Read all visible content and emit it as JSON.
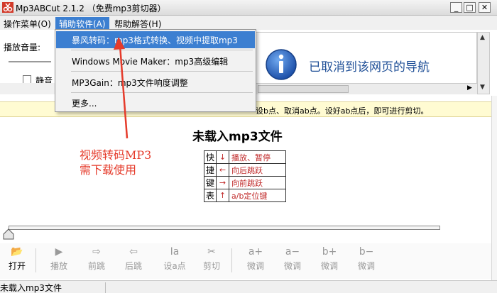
{
  "window": {
    "title": "Mp3ABCut 2.1.2 （免费mp3剪切器）",
    "minimize_glyph": "_",
    "maximize_glyph": "□",
    "close_glyph": "✕"
  },
  "menu": {
    "items": [
      "操作菜单(O)",
      "辅助软件(A)",
      "帮助解答(H)"
    ]
  },
  "dropdown": {
    "items": [
      "暴风转码：mp3格式转换、视频中提取mp3",
      "Windows Movie Maker：mp3高级编辑",
      "MP3Gain：mp3文件响度调整",
      "更多..."
    ]
  },
  "controls": {
    "volume_label": "播放音量:",
    "mute_label": "静音"
  },
  "browser": {
    "nav_message": "已取消到该网页的导航"
  },
  "hint": {
    "text": "设b点、取消ab点。设好ab点后，即可进行剪切。"
  },
  "main": {
    "no_file": "未载入mp3文件"
  },
  "annotation": {
    "line1": "视频转码MP3",
    "line2": "需下载使用"
  },
  "shortcuts": {
    "keys": [
      "快",
      "捷",
      "键",
      "表"
    ],
    "rows": [
      {
        "arrow": "↓",
        "desc": "播放、暂停"
      },
      {
        "arrow": "←",
        "desc": "向后跳跃"
      },
      {
        "arrow": "→",
        "desc": "向前跳跃"
      },
      {
        "arrow": "↑",
        "desc": "a/b定位键"
      }
    ]
  },
  "toolbar": {
    "tools": [
      {
        "icon": "📂",
        "label": "打开"
      },
      {
        "icon": "▶",
        "label": "播放"
      },
      {
        "icon": "⇨",
        "label": "前跳"
      },
      {
        "icon": "⇦",
        "label": "后跳"
      },
      {
        "icon": "Ia",
        "label": "设a点"
      },
      {
        "icon": "✂",
        "label": "剪切"
      },
      {
        "icon": "a+",
        "label": "微调"
      },
      {
        "icon": "a−",
        "label": "微调"
      },
      {
        "icon": "b+",
        "label": "微调"
      },
      {
        "icon": "b−",
        "label": "微调"
      }
    ]
  },
  "status": {
    "text": "未载入mp3文件"
  },
  "colors": {
    "menu_highlight": "#3c7fd1",
    "annotation": "#e53b2b",
    "hint_bg": "#fffbd2",
    "nav_text": "#1f4f97"
  }
}
